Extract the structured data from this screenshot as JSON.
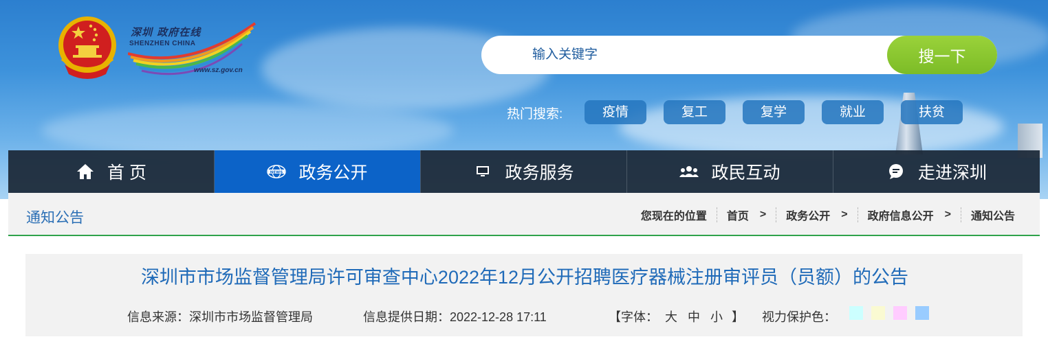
{
  "site": {
    "logo_cn": "深圳 政府在线",
    "logo_en": "SHENZHEN  CHINA",
    "logo_url": "www.sz.gov.cn"
  },
  "search": {
    "placeholder": "输入关键字",
    "button_label": "搜一下"
  },
  "hot_search": {
    "label": "热门搜索:",
    "tags": [
      "疫情",
      "复工",
      "复学",
      "就业",
      "扶贫"
    ]
  },
  "nav": {
    "items": [
      {
        "label": "首 页",
        "icon": "home-icon"
      },
      {
        "label": "政务公开",
        "icon": "news-icon",
        "active": true
      },
      {
        "label": "政务服务",
        "icon": "monitor-icon"
      },
      {
        "label": "政民互动",
        "icon": "people-icon"
      },
      {
        "label": "走进深圳",
        "icon": "chat-icon"
      }
    ]
  },
  "section": {
    "title": "通知公告"
  },
  "breadcrumb": {
    "label": "您现在的位置",
    "items": [
      "首页",
      "政务公开",
      "政府信息公开",
      "通知公告"
    ],
    "separator": ">"
  },
  "article": {
    "title": "深圳市市场监督管理局许可审查中心2022年12月公开招聘医疗器械注册审评员（员额）的公告",
    "source": "信息来源：深圳市市场监督管理局",
    "date": "信息提供日期：2022-12-28 17:11",
    "font_open": "【字体：",
    "font_large": "大",
    "font_medium": "中",
    "font_small": "小",
    "font_close": "】",
    "eye_label": "视力保护色：",
    "eye_colors": [
      "#ccffff",
      "#fafad2",
      "#ffccff",
      "#99ccff"
    ]
  },
  "colors": {
    "nav_active": "#0c63c8",
    "search_button": "#8cc832",
    "title_blue": "#1f6ab8",
    "divider_green": "#2ea24a"
  }
}
